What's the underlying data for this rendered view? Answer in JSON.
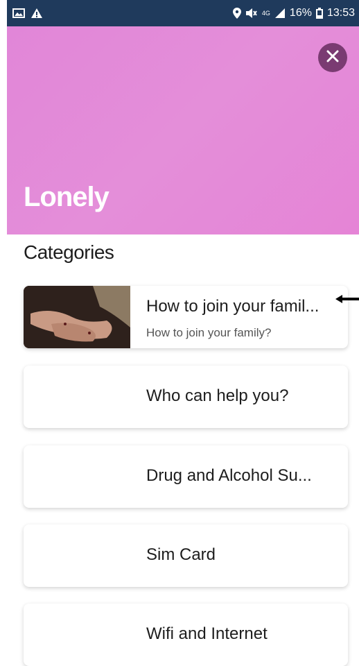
{
  "status_bar": {
    "battery": "16%",
    "time": "13:53",
    "network": "4G"
  },
  "hero": {
    "title": "Lonely",
    "background_color": "#e48ed9"
  },
  "section": {
    "title": "Categories"
  },
  "categories": [
    {
      "title": "How to join your famil...",
      "subtitle": "How to join your family?",
      "has_image": true
    },
    {
      "title": "Who can help you?"
    },
    {
      "title": "Drug and Alcohol Su..."
    },
    {
      "title": "Sim Card"
    },
    {
      "title": "Wifi and Internet"
    }
  ]
}
